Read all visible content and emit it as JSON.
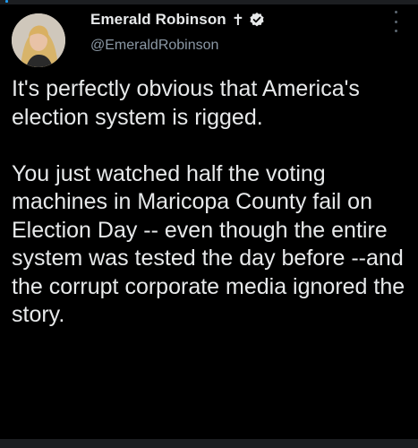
{
  "tweet": {
    "author": {
      "display_name": "Emerald Robinson",
      "name_suffix": "✝",
      "handle": "@EmeraldRobinson",
      "avatar_icon": "user-avatar",
      "verified_icon": "verified-badge-icon"
    },
    "paragraphs": [
      "It's perfectly obvious that America's election system is rigged.",
      "You just watched half the voting machines in Maricopa County fail on Election Day -- even though the entire system was tested the day before --and the corrupt corporate media ignored the story."
    ]
  },
  "colors": {
    "background": "#000000",
    "text": "#e7e9ea",
    "secondary_text": "#8b98a5",
    "accent": "#1d9bf0"
  }
}
